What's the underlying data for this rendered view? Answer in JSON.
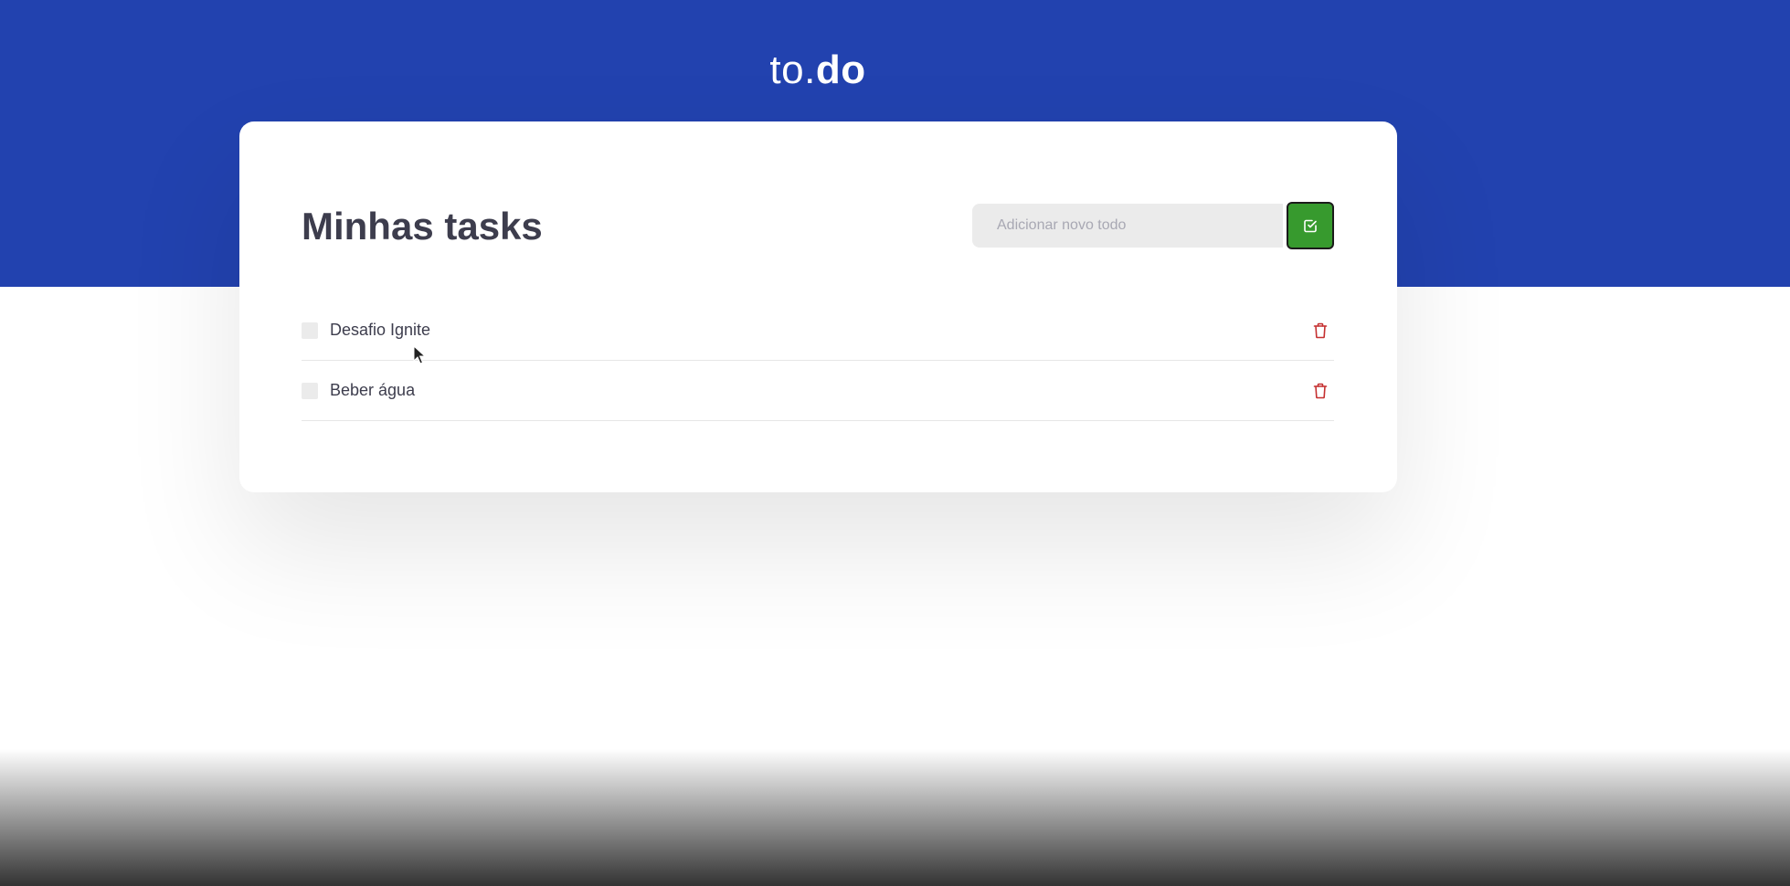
{
  "header": {
    "logo_light": "to.",
    "logo_bold": "do"
  },
  "card": {
    "title": "Minhas tasks",
    "new_task_placeholder": "Adicionar novo todo",
    "add_icon": "check-square-icon",
    "delete_icon": "trash-icon"
  },
  "tasks": [
    {
      "title": "Desafio Ignite",
      "done": false
    },
    {
      "title": "Beber água",
      "done": false
    }
  ],
  "colors": {
    "brand_blue": "#2242af",
    "add_button_green": "#379a2e",
    "delete_red": "#c53030",
    "text_dark": "#3d3d4d"
  }
}
